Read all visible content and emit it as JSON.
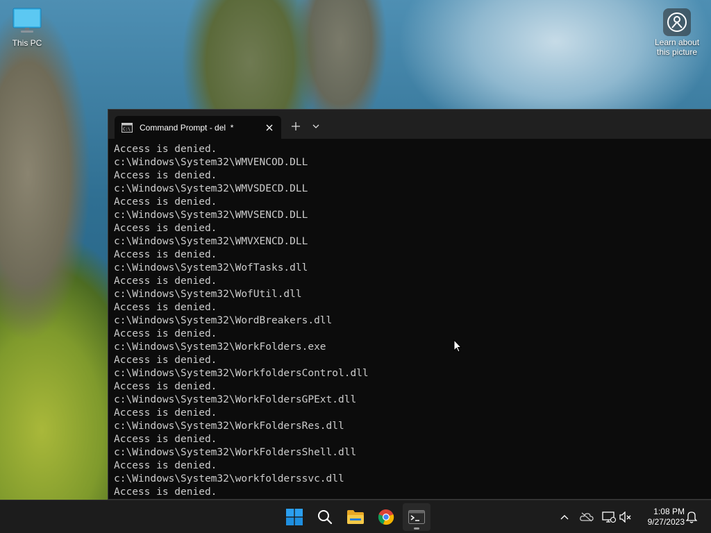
{
  "desktop": {
    "icons": [
      {
        "label": "This PC"
      },
      {
        "label": "Learn about\nthis picture"
      }
    ]
  },
  "terminal": {
    "tab_title": "Command Prompt - del  *",
    "new_tab_symbol": "+",
    "output_lines": [
      "Access is denied.",
      "c:\\Windows\\System32\\WMVENCOD.DLL",
      "Access is denied.",
      "c:\\Windows\\System32\\WMVSDECD.DLL",
      "Access is denied.",
      "c:\\Windows\\System32\\WMVSENCD.DLL",
      "Access is denied.",
      "c:\\Windows\\System32\\WMVXENCD.DLL",
      "Access is denied.",
      "c:\\Windows\\System32\\WofTasks.dll",
      "Access is denied.",
      "c:\\Windows\\System32\\WofUtil.dll",
      "Access is denied.",
      "c:\\Windows\\System32\\WordBreakers.dll",
      "Access is denied.",
      "c:\\Windows\\System32\\WorkFolders.exe",
      "Access is denied.",
      "c:\\Windows\\System32\\WorkfoldersControl.dll",
      "Access is denied.",
      "c:\\Windows\\System32\\WorkFoldersGPExt.dll",
      "Access is denied.",
      "c:\\Windows\\System32\\WorkFoldersRes.dll",
      "Access is denied.",
      "c:\\Windows\\System32\\WorkFoldersShell.dll",
      "Access is denied.",
      "c:\\Windows\\System32\\workfolderssvc.dll",
      "Access is denied."
    ]
  },
  "taskbar": {
    "apps": [
      "start-icon",
      "search-icon",
      "file-explorer-icon",
      "chrome-icon",
      "terminal-icon"
    ],
    "tray": [
      "chevron-up-icon",
      "onedrive-icon",
      "network-icon",
      "volume-muted-icon",
      "notification-bell-icon"
    ],
    "time": "1:08 PM",
    "date": "9/27/2023"
  },
  "colors": {
    "terminal_bg": "#0c0c0c",
    "titlebar_bg": "#202020",
    "console_text": "#cccccc",
    "taskbar_bg": "#1c1c1c",
    "start_blue": "#1f8fe0"
  }
}
